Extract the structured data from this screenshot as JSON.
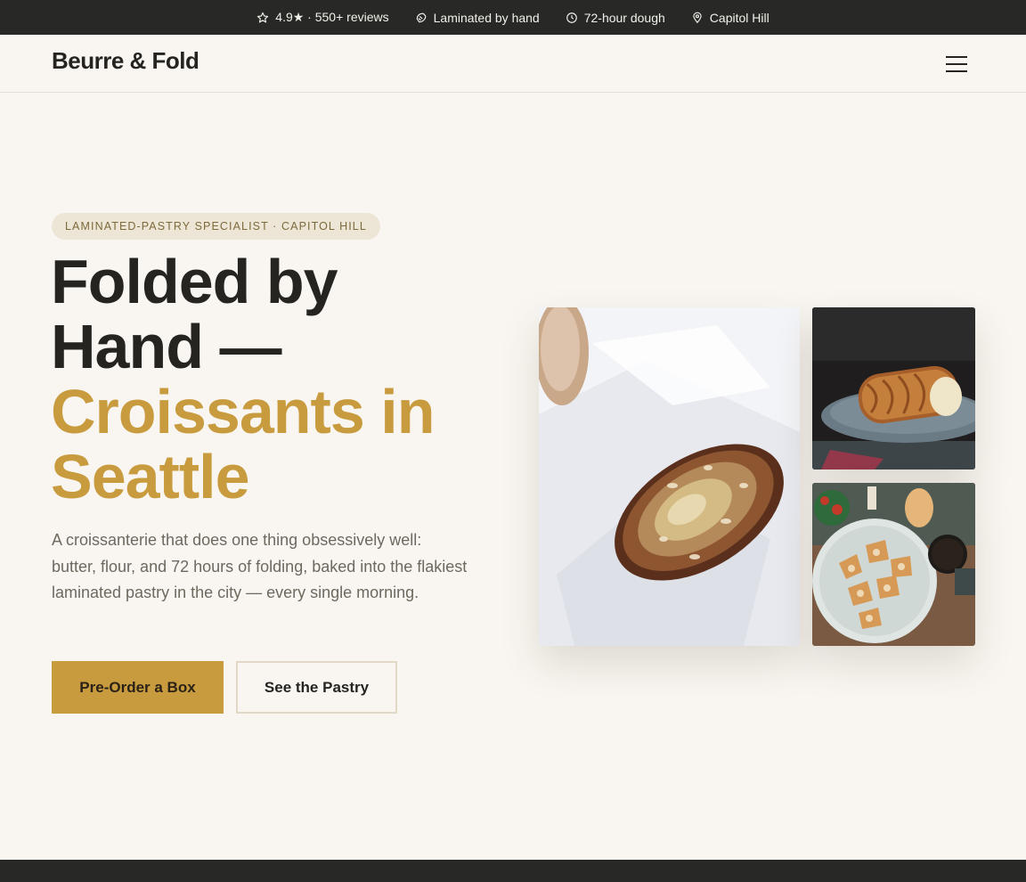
{
  "topbar": {
    "items": [
      {
        "icon": "star-icon",
        "label": "4.9★ · 550+ reviews"
      },
      {
        "icon": "fold-icon",
        "label": "Laminated by hand"
      },
      {
        "icon": "clock-icon",
        "label": "72-hour dough"
      },
      {
        "icon": "map-pin-icon",
        "label": "Capitol Hill"
      }
    ]
  },
  "nav": {
    "brand": "Beurre & Fold",
    "menu_icon": "hamburger-menu-icon"
  },
  "hero": {
    "eyebrow": "LAMINATED-PASTRY SPECIALIST · CAPITOL HILL",
    "headline_dark_1": "Folded by",
    "headline_dark_2": "Hand —",
    "headline_gold_1": "Croissants in",
    "headline_gold_2": "Seattle",
    "lede": "A croissanterie that does one thing obsessively well: butter, flour, and 72 hours of folding, baked into the flakiest laminated pastry in the city — every single morning.",
    "cta_primary": "Pre-Order a Box",
    "cta_secondary": "See the Pastry"
  },
  "gallery": {
    "photos": [
      "almond-croissant-photo",
      "pastry-roll-photo",
      "danish-platter-photo"
    ]
  },
  "colors": {
    "accent": "#c89b3e",
    "dark": "#282826",
    "background": "#f9f6f1",
    "badge_bg": "#ede6d6"
  }
}
